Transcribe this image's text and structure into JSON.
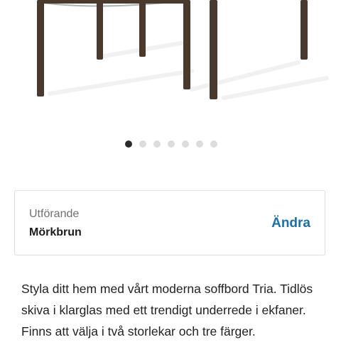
{
  "product_image": {
    "product": "coffee-table",
    "colors": {
      "wood": "#4a3a2e",
      "glass": "#a9b4b1"
    }
  },
  "carousel": {
    "slide_count": 7,
    "active_index": 0,
    "colors": {
      "active": "#2b2b2b",
      "inactive": "#dcdcdc"
    }
  },
  "variant": {
    "label": "Utförande",
    "value": "Mörkbrun",
    "change_label": "Ändra",
    "colors": {
      "link": "#1f6fa8"
    }
  },
  "description": {
    "text": "Styla ditt hem med vårt moderna soffbord Tria. Tidlös skiva i klarglas med ett trendigt underrede i ekfaner. Finns att välja i två storlekar och tre färger."
  }
}
